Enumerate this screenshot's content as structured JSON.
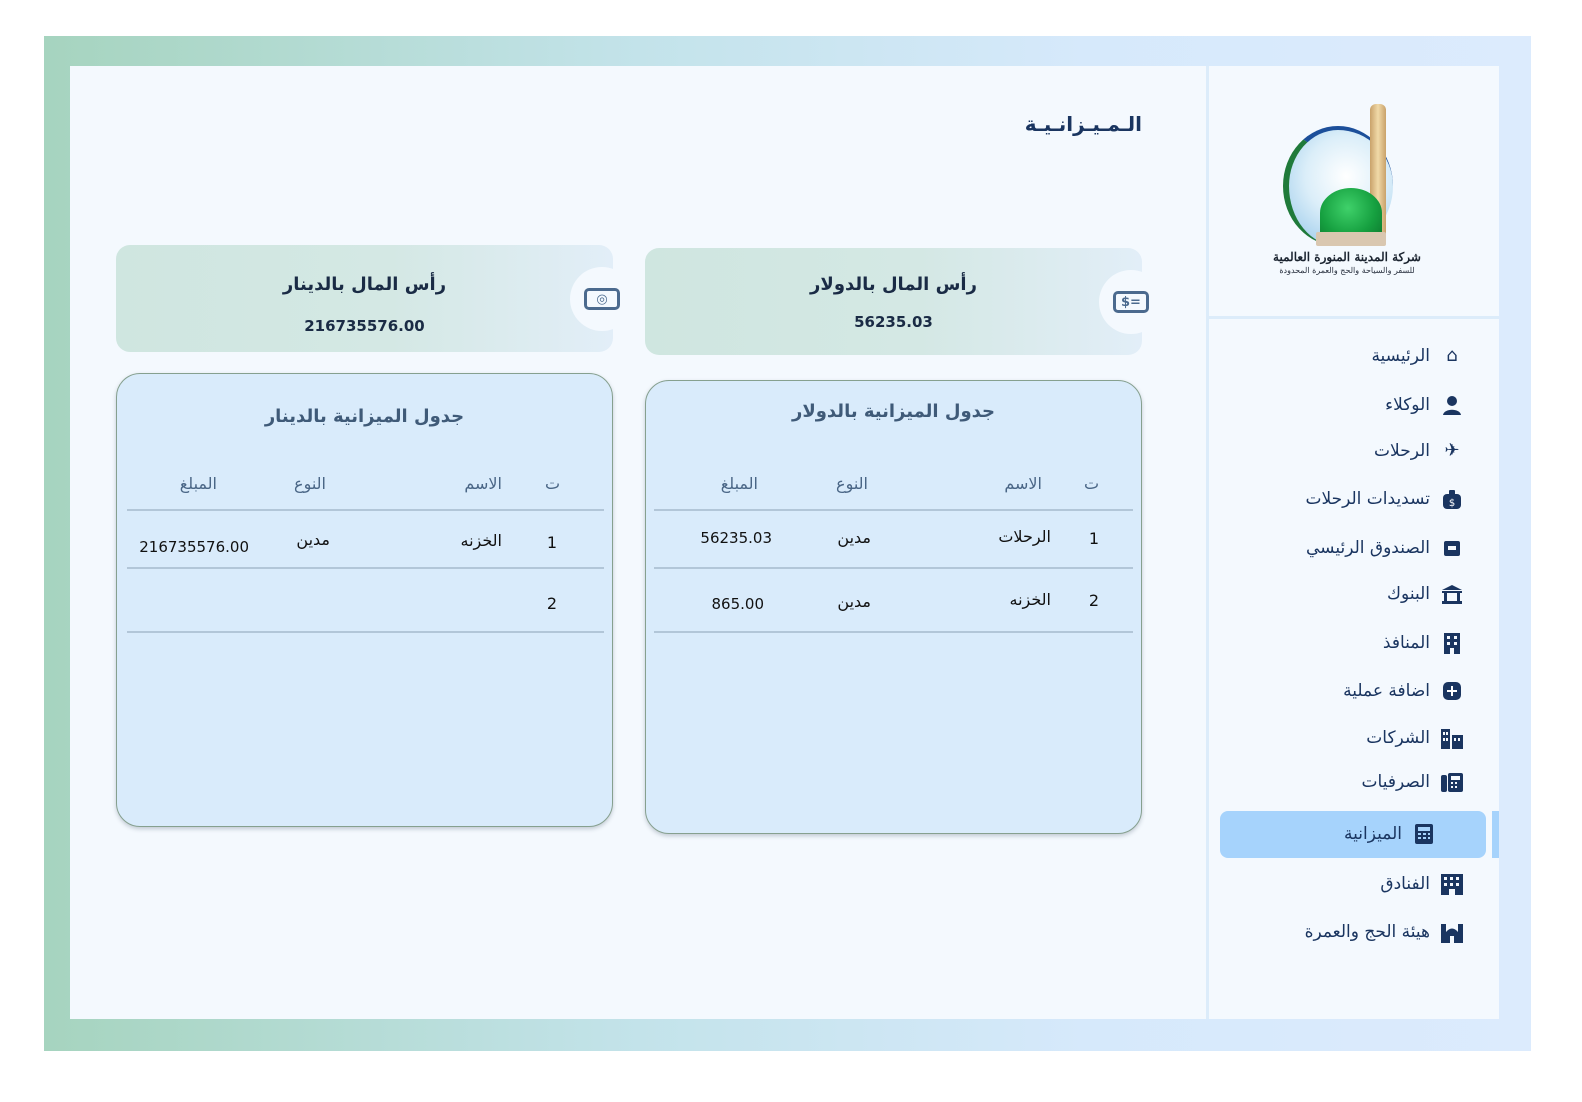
{
  "company": {
    "name": "شركة المدينة المنورة العالمية",
    "tagline": "للسفر والسياحة والحج والعمرة المحدودة"
  },
  "sidebar": {
    "items": [
      {
        "label": "الرئيسية",
        "icon": "home-icon"
      },
      {
        "label": "الوكلاء",
        "icon": "user-icon"
      },
      {
        "label": "الرحلات",
        "icon": "plane-icon"
      },
      {
        "label": "تسديدات الرحلات",
        "icon": "money-bag-icon"
      },
      {
        "label": "الصندوق الرئيسي",
        "icon": "cash-box-icon"
      },
      {
        "label": "البنوك",
        "icon": "bank-icon"
      },
      {
        "label": "المنافذ",
        "icon": "building-icon"
      },
      {
        "label": "اضافة عملية",
        "icon": "plus-icon"
      },
      {
        "label": "الشركات",
        "icon": "city-icon"
      },
      {
        "label": "الصرفيات",
        "icon": "fax-icon"
      },
      {
        "label": "الميزانية",
        "icon": "calculator-icon",
        "active": true
      },
      {
        "label": "الفنادق",
        "icon": "hotel-icon"
      },
      {
        "label": "هيئة الحج والعمرة",
        "icon": "mosque-icon"
      }
    ]
  },
  "main": {
    "title": "الـمـيـزانـيـة",
    "cards": {
      "usd": {
        "label": "رأس المال بالدولار",
        "value": "56235.03",
        "icon_text": "$="
      },
      "iqd": {
        "label": "رأس المال بالدينار",
        "value": "216735576.00",
        "icon_text": "◎"
      }
    },
    "tables": {
      "usd": {
        "title": "جدول الميزانية بالدولار",
        "headers": [
          "ت",
          "الاسم",
          "النوع",
          "المبلغ"
        ],
        "rows": [
          {
            "no": "1",
            "name": "الرحلات",
            "type": "مدين",
            "amount": "56235.03"
          },
          {
            "no": "2",
            "name": "الخزنه",
            "type": "مدين",
            "amount": "865.00"
          }
        ]
      },
      "iqd": {
        "title": "جدول الميزانية بالدينار",
        "headers": [
          "ت",
          "الاسم",
          "النوع",
          "المبلغ"
        ],
        "rows": [
          {
            "no": "1",
            "name": "الخزنه",
            "type": "مدين",
            "amount": "216735576.00"
          },
          {
            "no": "2",
            "name": "",
            "type": "",
            "amount": ""
          }
        ]
      }
    }
  },
  "colors": {
    "accent": "#a6d3fc",
    "navy": "#1a3560",
    "card_bg": "#d4e8e4",
    "table_bg": "#d9ebfb"
  }
}
